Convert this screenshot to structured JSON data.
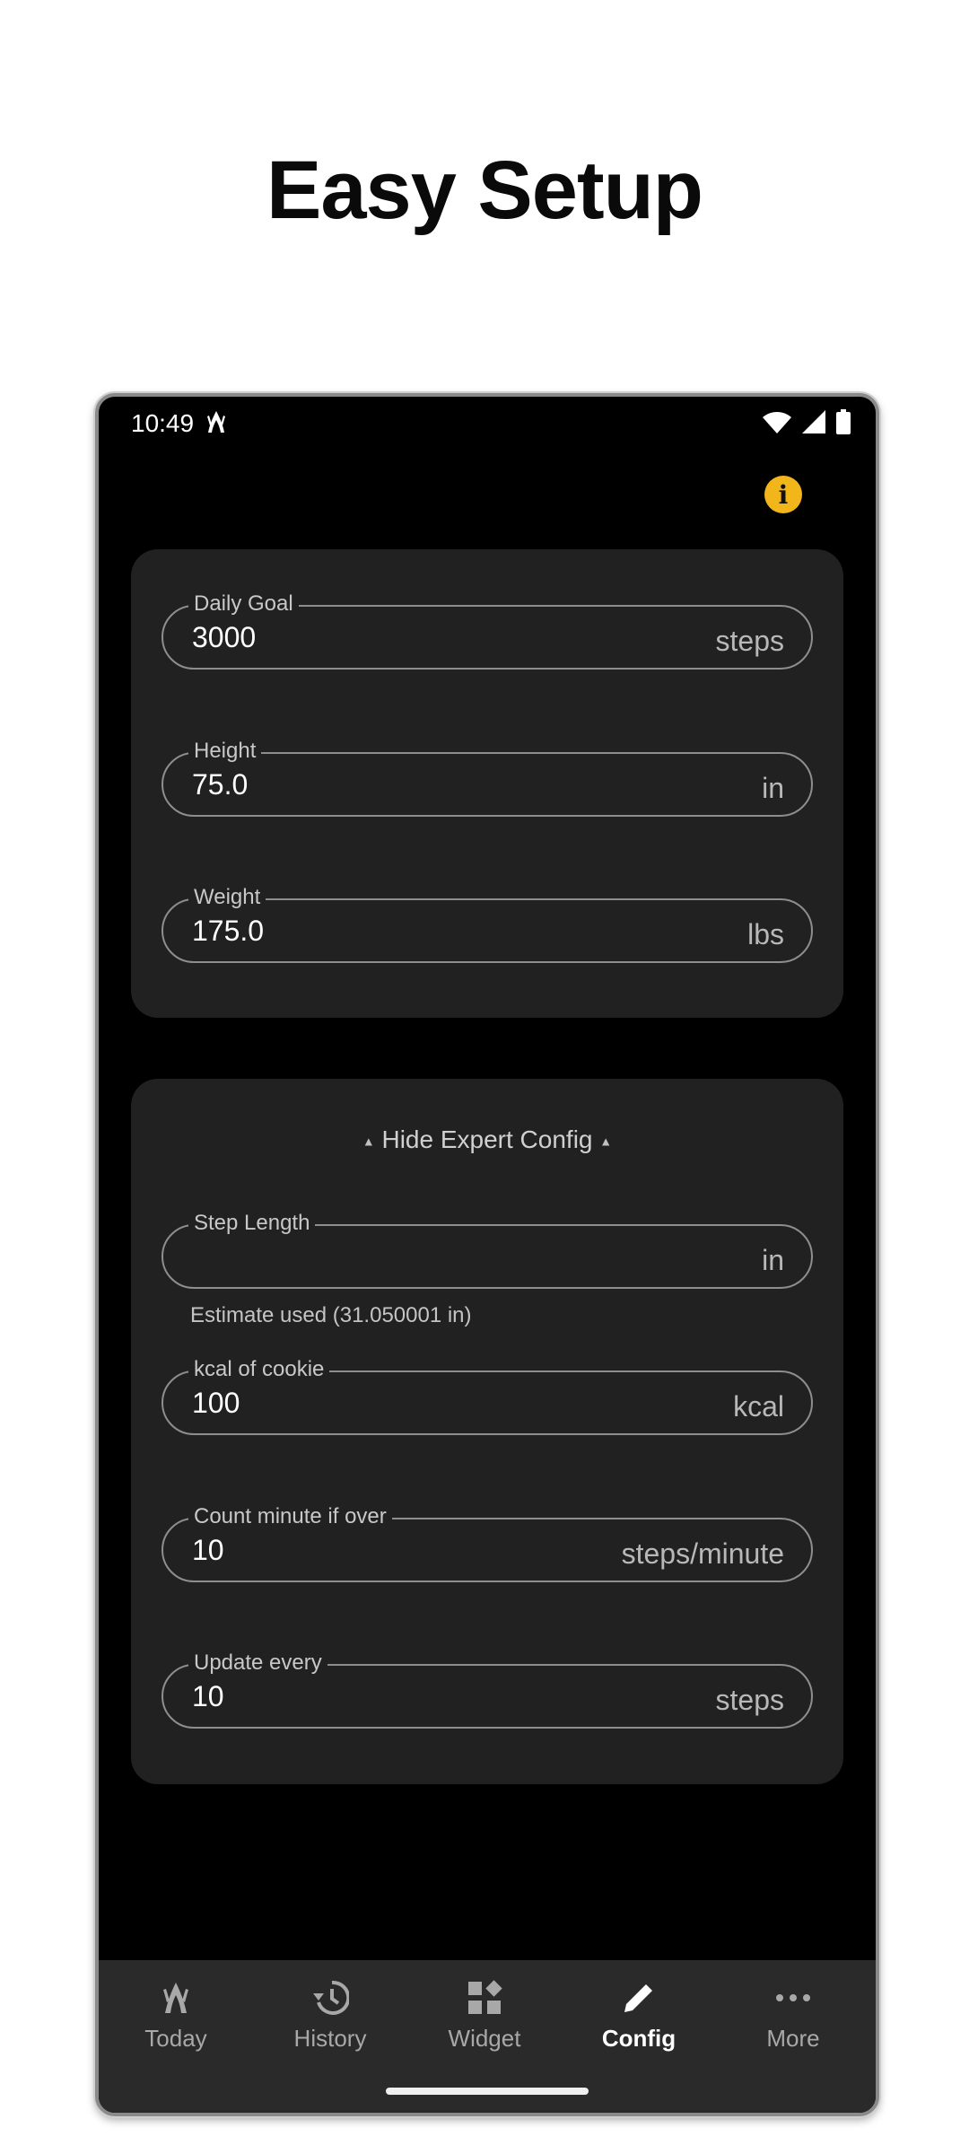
{
  "headline": "Easy Setup",
  "status": {
    "time": "10:49"
  },
  "basic_fields": [
    {
      "label": "Daily Goal",
      "value": "3000",
      "unit": "steps"
    },
    {
      "label": "Height",
      "value": "75.0",
      "unit": "in"
    },
    {
      "label": "Weight",
      "value": "175.0",
      "unit": "lbs"
    }
  ],
  "expert": {
    "toggle_label": "Hide Expert Config",
    "step_length": {
      "label": "Step Length",
      "value": "",
      "unit": "in",
      "hint": "Estimate used (31.050001 in)"
    },
    "kcal": {
      "label": "kcal of cookie",
      "value": "100",
      "unit": "kcal"
    },
    "count_minute": {
      "label": "Count minute if over",
      "value": "10",
      "unit": "steps/minute"
    },
    "update_every": {
      "label": "Update every",
      "value": "10",
      "unit": "steps"
    }
  },
  "nav": [
    {
      "label": "Today",
      "icon": "paw-icon"
    },
    {
      "label": "History",
      "icon": "history-icon"
    },
    {
      "label": "Widget",
      "icon": "widget-icon"
    },
    {
      "label": "Config",
      "icon": "pencil-icon",
      "active": true
    },
    {
      "label": "More",
      "icon": "more-icon"
    }
  ],
  "colors": {
    "accent": "#f2b51a",
    "background": "#000000",
    "card": "#212121",
    "navbar": "#2a2a2a"
  }
}
